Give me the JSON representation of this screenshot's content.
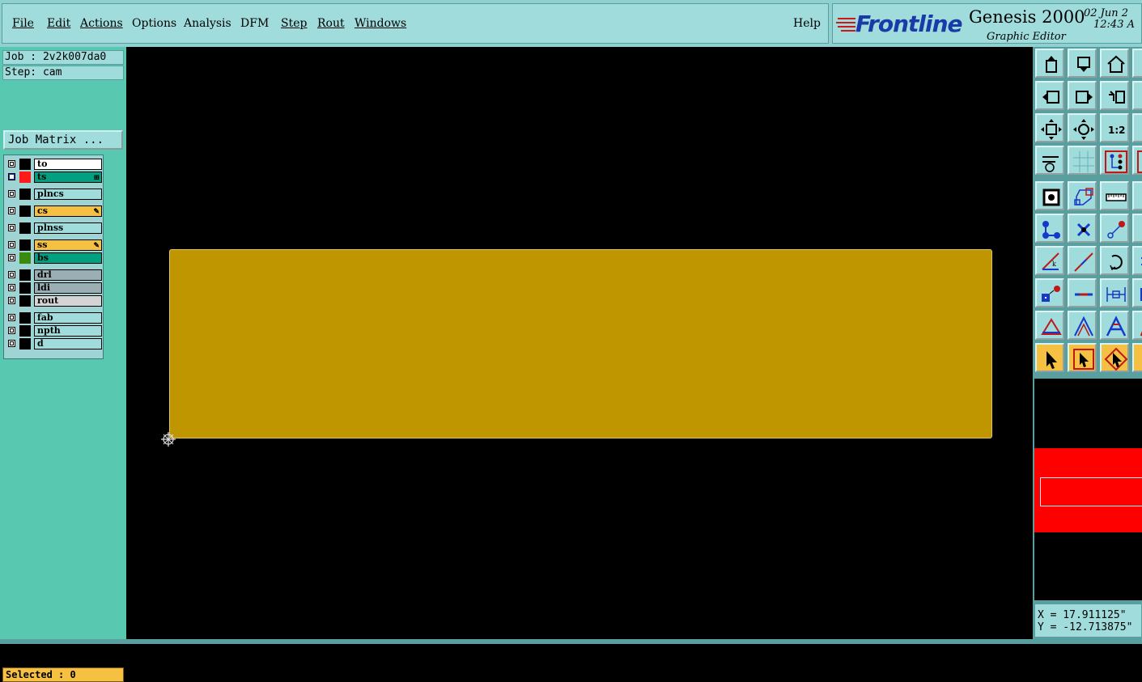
{
  "menu": {
    "items": [
      {
        "id": "file",
        "label": "File"
      },
      {
        "id": "edit",
        "label": "Edit"
      },
      {
        "id": "actions",
        "label": "Actions"
      },
      {
        "id": "options",
        "label": "Options"
      },
      {
        "id": "analysis",
        "label": "Analysis"
      },
      {
        "id": "dfm",
        "label": "DFM"
      },
      {
        "id": "step",
        "label": "Step"
      },
      {
        "id": "rout",
        "label": "Rout"
      },
      {
        "id": "windows",
        "label": "Windows"
      }
    ],
    "help": "Help"
  },
  "brand": {
    "logo": "Frontline",
    "title": "Genesis 2000",
    "subtitle": "Graphic Editor",
    "date": "02 Jun 2",
    "time": "12:43 A"
  },
  "job": {
    "job_line": "Job : 2v2k007da0",
    "step_line": "Step: cam",
    "matrix_button": "Job Matrix ..."
  },
  "layers": [
    {
      "name": "to",
      "color": "#ffffff",
      "swatch": "#000000",
      "marker": "",
      "active": false
    },
    {
      "name": "ts",
      "color": "#00a080",
      "swatch": "#ff1a1a",
      "marker": "⊞",
      "active": true
    },
    {
      "name": "plncs",
      "color": "#a0dcdc",
      "swatch": "#000000",
      "marker": "",
      "active": false
    },
    {
      "name": "cs",
      "color": "#f6c042",
      "swatch": "#000000",
      "marker": "✎",
      "active": false
    },
    {
      "name": "plnss",
      "color": "#a0dcdc",
      "swatch": "#000000",
      "marker": "",
      "active": false
    },
    {
      "name": "ss",
      "color": "#f6c042",
      "swatch": "#000000",
      "marker": "✎",
      "active": false
    },
    {
      "name": "bs",
      "color": "#00a080",
      "swatch": "#3a8a10",
      "marker": "",
      "active": false
    },
    {
      "name": "drl",
      "color": "#9aaeb4",
      "swatch": "#000000",
      "marker": "",
      "active": false
    },
    {
      "name": "ldi",
      "color": "#9aaeb4",
      "swatch": "#000000",
      "marker": "",
      "active": false
    },
    {
      "name": "rout",
      "color": "#d4d4d4",
      "swatch": "#000000",
      "marker": "",
      "active": false
    },
    {
      "name": "fab",
      "color": "#a0dcdc",
      "swatch": "#000000",
      "marker": "",
      "active": false
    },
    {
      "name": "npth",
      "color": "#a0dcdc",
      "swatch": "#000000",
      "marker": "",
      "active": false
    },
    {
      "name": "d",
      "color": "#a0dcdc",
      "swatch": "#000000",
      "marker": "",
      "active": false
    }
  ],
  "status": {
    "selected": "Selected : 0"
  },
  "coords": {
    "x": "X = 17.911125\"",
    "y": "Y = -12.713875\""
  },
  "colors": {
    "board_fill": "#bf9500",
    "minimap_band": "#ff0000"
  },
  "toolbar_icons": [
    "pan-up-icon",
    "pan-down-icon",
    "home-icon",
    "zoom-extent-icon",
    "pan-left-icon",
    "pan-right-icon",
    "undo-zoom-icon",
    "zoom-window-icon",
    "fit-icon",
    "center-icon",
    "scale-1to2-icon",
    "zoom-box-icon",
    "settings-icon",
    "grid-icon",
    "snap-icon",
    "snap-extra-icon",
    "display-icon",
    "outline-icon",
    "ruler-icon",
    "measure-icon",
    "nodes-icon",
    "delete-point-icon",
    "connect-icon",
    "arc-icon",
    "angle-icon",
    "line-icon",
    "rotate-icon",
    "extend-icon",
    "pad-icon",
    "track-icon",
    "dimension-icon",
    "flag-icon",
    "triangle-icon",
    "peak-icon",
    "text-a-icon",
    "arrow-a-icon",
    "select-icon",
    "select-box-icon",
    "select-poly-icon",
    "select-extra-icon"
  ]
}
